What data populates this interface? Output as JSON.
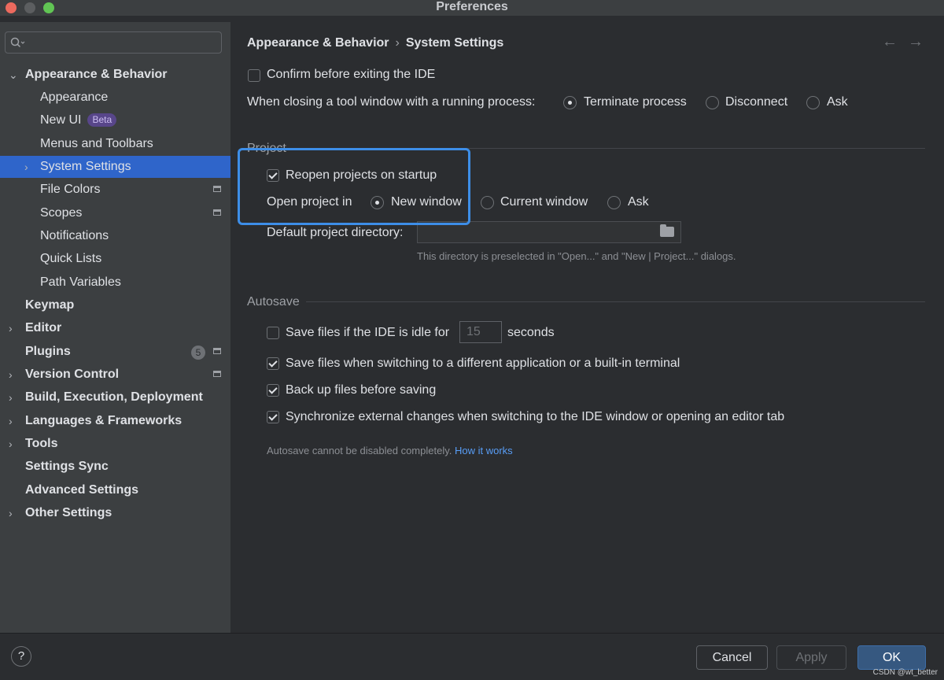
{
  "window": {
    "title": "Preferences"
  },
  "sidebar": {
    "search_placeholder": "",
    "items": [
      {
        "label": "Appearance & Behavior",
        "expanded": true
      },
      {
        "label": "Appearance"
      },
      {
        "label": "New UI",
        "badge": "Beta"
      },
      {
        "label": "Menus and Toolbars"
      },
      {
        "label": "System Settings",
        "selected": true
      },
      {
        "label": "File Colors"
      },
      {
        "label": "Scopes"
      },
      {
        "label": "Notifications"
      },
      {
        "label": "Quick Lists"
      },
      {
        "label": "Path Variables"
      },
      {
        "label": "Keymap"
      },
      {
        "label": "Editor"
      },
      {
        "label": "Plugins",
        "count": "5"
      },
      {
        "label": "Version Control"
      },
      {
        "label": "Build, Execution, Deployment"
      },
      {
        "label": "Languages & Frameworks"
      },
      {
        "label": "Tools"
      },
      {
        "label": "Settings Sync"
      },
      {
        "label": "Advanced Settings"
      },
      {
        "label": "Other Settings"
      }
    ]
  },
  "breadcrumb": {
    "parent": "Appearance & Behavior",
    "separator": "›",
    "current": "System Settings"
  },
  "general": {
    "confirm_exit_label": "Confirm before exiting the IDE",
    "confirm_exit_checked": false,
    "closing_label": "When closing a tool window with a running process:",
    "closing_options": [
      "Terminate process",
      "Disconnect",
      "Ask"
    ],
    "closing_selected": "Terminate process"
  },
  "project": {
    "section_title": "Project",
    "reopen_label": "Reopen projects on startup",
    "reopen_checked": true,
    "open_in_label": "Open project in",
    "open_in_options": [
      "New window",
      "Current window",
      "Ask"
    ],
    "open_in_selected": "New window",
    "default_dir_label": "Default project directory:",
    "default_dir_value": "",
    "default_dir_hint": "This directory is preselected in \"Open...\" and \"New | Project...\" dialogs."
  },
  "autosave": {
    "section_title": "Autosave",
    "idle_label": "Save files if the IDE is idle for",
    "idle_checked": false,
    "idle_value": "15",
    "idle_unit": "seconds",
    "switch_label": "Save files when switching to a different application or a built-in terminal",
    "switch_checked": true,
    "backup_label": "Back up files before saving",
    "backup_checked": true,
    "sync_label": "Synchronize external changes when switching to the IDE window or opening an editor tab",
    "sync_checked": true,
    "hint": "Autosave cannot be disabled completely.",
    "hint_link": "How it works"
  },
  "buttons": {
    "help": "?",
    "cancel": "Cancel",
    "apply": "Apply",
    "ok": "OK"
  },
  "watermark": "CSDN @wt_better",
  "colors": {
    "accent": "#2f65ca",
    "highlight_box": "#3d8ee8",
    "link": "#589df6",
    "ok_button": "#365880"
  }
}
